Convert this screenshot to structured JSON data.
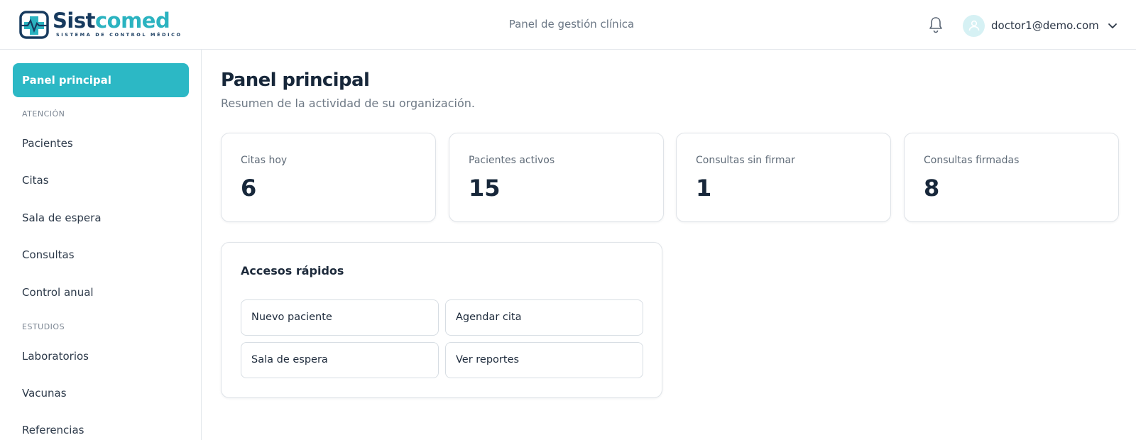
{
  "brand": {
    "name_part1": "Sist",
    "name_part2": "comed",
    "tagline": "SISTEMA DE CONTROL MÉDICO"
  },
  "header": {
    "title": "Panel de gestión clínica",
    "user_email": "doctor1@demo.com"
  },
  "sidebar": {
    "active": "Panel principal",
    "sections": [
      {
        "title": "ATENCIÓN",
        "items": [
          "Pacientes",
          "Citas",
          "Sala de espera",
          "Consultas",
          "Control anual"
        ]
      },
      {
        "title": "ESTUDIOS",
        "items": [
          "Laboratorios",
          "Vacunas",
          "Referencias"
        ]
      }
    ]
  },
  "main": {
    "title": "Panel principal",
    "subtitle": "Resumen de la actividad de su organización.",
    "stats": [
      {
        "label": "Citas hoy",
        "value": "6"
      },
      {
        "label": "Pacientes activos",
        "value": "15"
      },
      {
        "label": "Consultas sin firmar",
        "value": "1"
      },
      {
        "label": "Consultas firmadas",
        "value": "8"
      }
    ],
    "quick_access": {
      "title": "Accesos rápidos",
      "buttons": [
        "Nuevo paciente",
        "Agendar cita",
        "Sala de espera",
        "Ver reportes"
      ]
    }
  },
  "colors": {
    "accent": "#2cb8c5",
    "brand_dark": "#173a5e",
    "text_dark": "#17273a"
  }
}
